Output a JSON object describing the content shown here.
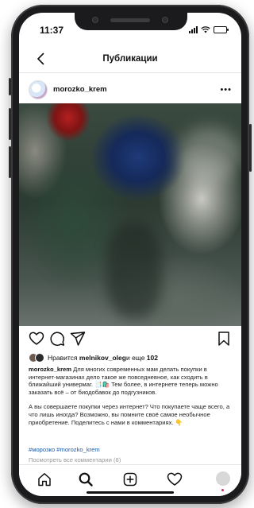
{
  "status": {
    "time": "11:37",
    "battery_level": 0.75
  },
  "nav": {
    "title": "Публикации"
  },
  "post": {
    "username": "morozko_krem",
    "more": "•••",
    "likes": {
      "prefix": "Нравится ",
      "user": "melnikov_oleg",
      "middle": " и еще ",
      "count": "102"
    },
    "caption": {
      "author": "morozko_krem",
      "paragraph1": " Для многих современных мам делать покупки в интернет-магазинах дело такое же повседневное, как сходить в ближайший универмаг. 📑🛍️ Тем более, в интернете теперь можно заказать всё – от биодобавок до подгузников.",
      "paragraph2": "А вы совершаете покупки через интернет? Что покупаете чаще всего, а что лишь иногда? Возможно, вы помните своё самое необычное приобретение. Поделитесь с нами в комментариях. 👇"
    },
    "hashtags": [
      "#морозко",
      "#morozko_krem"
    ],
    "comments_link": "Посмотреть все комментарии (8)"
  },
  "icons": {
    "back": "back-chevron-icon",
    "like": "heart-icon",
    "comment": "comment-icon",
    "share": "send-icon",
    "save": "bookmark-icon",
    "home": "home-icon",
    "search": "search-icon",
    "add": "add-post-icon",
    "activity": "heart-icon",
    "profile": "profile-icon"
  },
  "colors": {
    "hashtag": "#1e5aa6",
    "muted": "#999999",
    "notification_dot": "#e0245e"
  }
}
